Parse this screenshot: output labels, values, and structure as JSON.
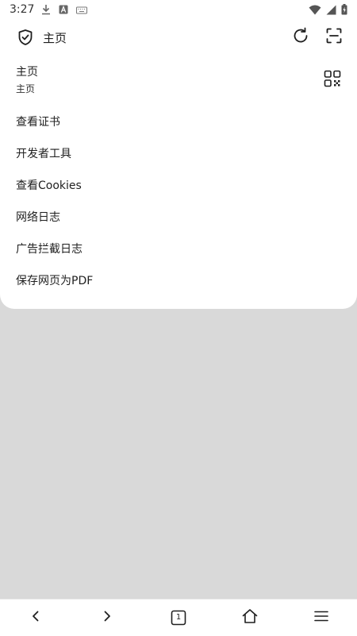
{
  "status_bar": {
    "time": "3:27",
    "left_icons": [
      "download-icon",
      "a-box-icon",
      "keyboard-icon"
    ],
    "right_icons": [
      "wifi-icon",
      "signal-icon",
      "battery-icon"
    ]
  },
  "toolbar": {
    "title": "主页",
    "icons": [
      "shield-check-icon",
      "refresh-icon",
      "scan-icon"
    ]
  },
  "page_info": {
    "title": "主页",
    "url": "主页"
  },
  "menu": {
    "items": [
      {
        "label": "查看证书"
      },
      {
        "label": "开发者工具"
      },
      {
        "label": "查看Cookies"
      },
      {
        "label": "网络日志"
      },
      {
        "label": "广告拦截日志"
      },
      {
        "label": "保存网页为PDF"
      }
    ]
  },
  "bottom_nav": {
    "tab_count": "1",
    "icons": [
      "back-icon",
      "forward-icon",
      "tabs-icon",
      "home-icon",
      "menu-icon"
    ]
  },
  "colors": {
    "sheet_bg": "#ffffff",
    "backdrop": "#d9d9d9",
    "text": "#1f1f1f"
  }
}
